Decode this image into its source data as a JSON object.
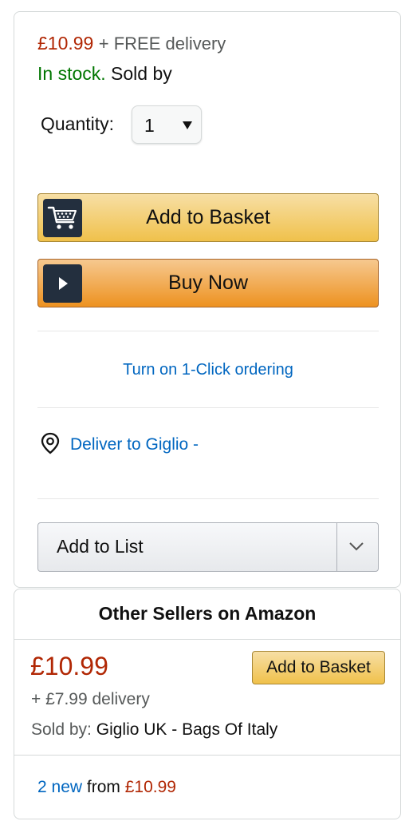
{
  "buybox": {
    "price": "£10.99",
    "delivery": "+ FREE delivery",
    "stock": "In stock.",
    "sold_by": "Sold by",
    "quantity_label": "Quantity:",
    "quantity_value": "1",
    "add_to_basket": "Add to Basket",
    "buy_now": "Buy Now",
    "one_click": "Turn on 1-Click ordering",
    "deliver_to": "Deliver to Giglio -",
    "add_to_list": "Add to List"
  },
  "other_sellers": {
    "heading": "Other Sellers on Amazon",
    "price": "£10.99",
    "delivery": "+ £7.99 delivery",
    "sold_by_label": "Sold by:",
    "seller": "Giglio UK - Bags Of Italy",
    "add_to_basket": "Add to Basket",
    "new_count": "2 new",
    "from_label": "from",
    "from_price": "£10.99"
  },
  "colors": {
    "price": "#b12704",
    "in_stock": "#007600",
    "link": "#0066c0",
    "basket_button": "#f0c14b",
    "buy_button": "#ed9220"
  },
  "icons": [
    "cart-icon",
    "play-icon",
    "location-pin-icon",
    "chevron-down-icon",
    "dropdown-arrow-icon"
  ]
}
